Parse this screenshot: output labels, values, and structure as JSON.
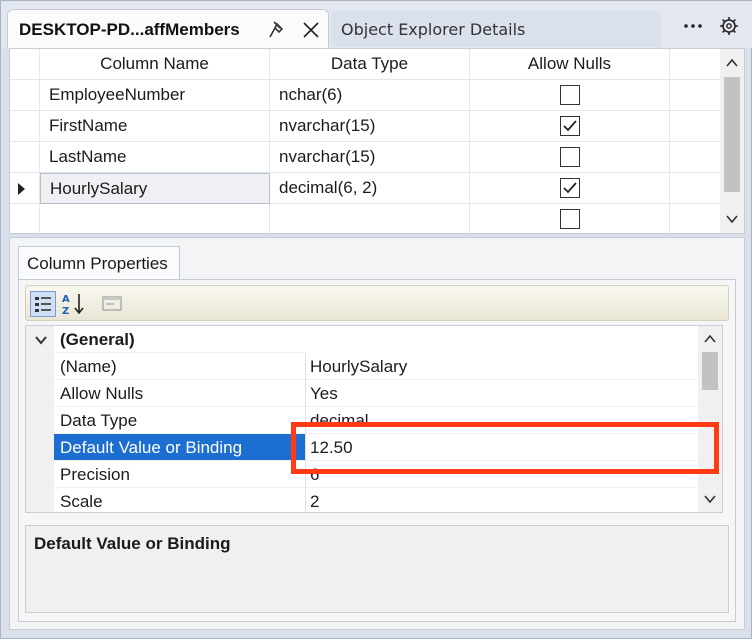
{
  "tabs": {
    "active_title": "DESKTOP-PD...affMembers",
    "inactive_title": "Object Explorer Details"
  },
  "grid": {
    "headers": [
      "Column Name",
      "Data Type",
      "Allow Nulls"
    ],
    "rows": [
      {
        "name": "EmployeeNumber",
        "type": "nchar(6)",
        "allow_nulls": false
      },
      {
        "name": "FirstName",
        "type": "nvarchar(15)",
        "allow_nulls": true
      },
      {
        "name": "LastName",
        "type": "nvarchar(15)",
        "allow_nulls": false
      },
      {
        "name": "HourlySalary",
        "type": "decimal(6, 2)",
        "allow_nulls": true
      },
      {
        "name": "",
        "type": "",
        "allow_nulls": false
      }
    ]
  },
  "properties_tab": "Column Properties",
  "properties": {
    "group": "(General)",
    "rows": [
      {
        "key": "(Name)",
        "value": "HourlySalary"
      },
      {
        "key": "Allow Nulls",
        "value": "Yes"
      },
      {
        "key": "Data Type",
        "value": "decimal"
      },
      {
        "key": "Default Value or Binding",
        "value": "12.50"
      },
      {
        "key": "Precision",
        "value": "6"
      },
      {
        "key": "Scale",
        "value": "2"
      }
    ]
  },
  "description": {
    "title": "Default Value or Binding"
  },
  "colors": {
    "selection": "#1c6fd1",
    "highlight": "#ff3b17"
  }
}
